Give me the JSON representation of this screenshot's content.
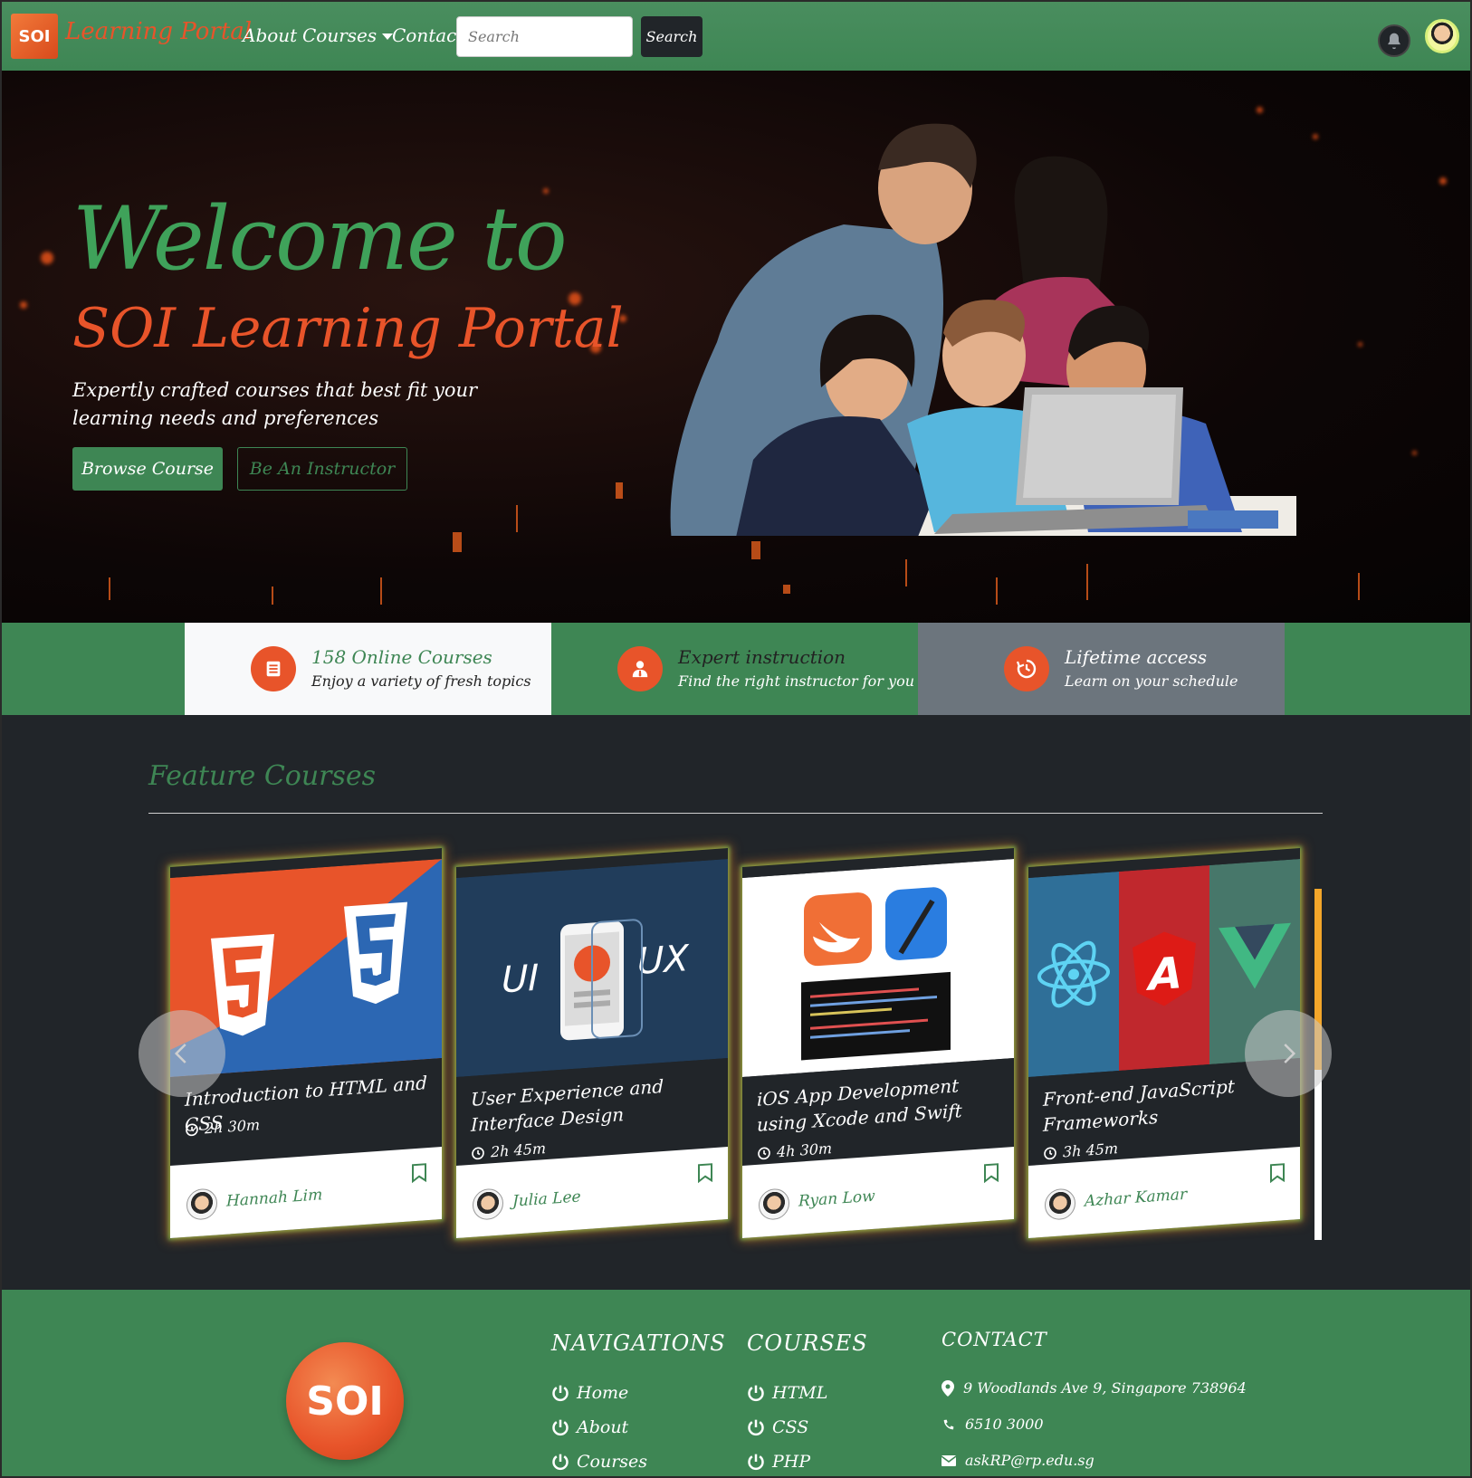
{
  "navbar": {
    "logo_text": "SOI",
    "brand": "Learning Portal",
    "links": [
      "About",
      "Courses",
      "Contact"
    ],
    "search_placeholder": "Search",
    "search_button": "Search",
    "icons": [
      "bell-icon",
      "user-avatar"
    ]
  },
  "hero": {
    "welcome": "Welcome to",
    "portal_title": "SOI Learning Portal",
    "tagline": "Expertly crafted courses that best fit your learning needs and preferences",
    "browse_button": "Browse Course",
    "instructor_button": "Be An Instructor"
  },
  "features": [
    {
      "title": "158 Online Courses",
      "subtitle": "Enjoy a variety of fresh topics",
      "icon": "book-icon"
    },
    {
      "title": "Expert instruction",
      "subtitle": "Find the right instructor for you",
      "icon": "user-tie-icon"
    },
    {
      "title": "Lifetime access",
      "subtitle": "Learn on your schedule",
      "icon": "history-icon"
    }
  ],
  "courses_section": {
    "title": "Feature Courses",
    "cards": [
      {
        "title": "Introduction to HTML and CSS",
        "duration": "2h 30m",
        "instructor": "Hannah Lim"
      },
      {
        "title": "User Experience and Interface Design",
        "duration": "2h 45m",
        "instructor": "Julia Lee"
      },
      {
        "title": "iOS App Development using Xcode and Swift",
        "duration": "4h 30m",
        "instructor": "Ryan Low"
      },
      {
        "title": "Front-end JavaScript Frameworks",
        "duration": "3h 45m",
        "instructor": "Azhar Kamar"
      }
    ],
    "thumb_text": {
      "ui": "UI",
      "ux": "UX",
      "angular": "A"
    }
  },
  "footer": {
    "logo_text": "SOI",
    "nav_heading": "NAVIGATIONS",
    "nav_links": [
      "Home",
      "About",
      "Courses"
    ],
    "courses_heading": "COURSES",
    "course_links": [
      "HTML",
      "CSS",
      "PHP"
    ],
    "contact_heading": "CONTACT",
    "address": "9 Woodlands Ave 9, Singapore 738964",
    "phone": "6510 3000",
    "email": "askRP@rp.edu.sg"
  },
  "colors": {
    "green": "#3e8654",
    "orange": "#e8542a",
    "dark": "#212529",
    "light": "#f8f9fa",
    "gray": "#6c757d"
  }
}
